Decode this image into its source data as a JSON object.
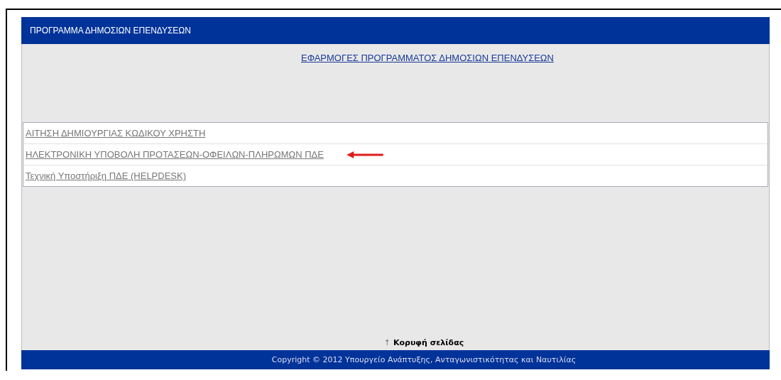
{
  "header": {
    "title": "ΠΡΟΓΡΑΜΜΑ ΔΗΜΟΣΙΩΝ ΕΠΕΝΔΥΣΕΩΝ"
  },
  "main": {
    "heading": "ΕΦΑΡΜΟΓΕΣ ΠΡΟΓΡΑΜΜΑΤΟΣ ΔΗΜΟΣΙΩΝ ΕΠΕΝΔΥΣΕΩΝ",
    "links": [
      {
        "label": "ΑΙΤΗΣΗ ΔΗΜΙΟΥΡΓΙΑΣ ΚΩΔΙΚΟΥ ΧΡΗΣΤΗ",
        "highlighted": false
      },
      {
        "label": "ΗΛΕΚΤΡΟΝΙΚΗ ΥΠΟΒΟΛΗ ΠΡΟΤΑΣΕΩΝ-ΟΦΕΙΛΩΝ-ΠΛΗΡΩΜΩΝ ΠΔΕ",
        "highlighted": true
      },
      {
        "label": "Τεχνική Υποστήριξη ΠΔΕ (HELPDESK)",
        "highlighted": false
      }
    ],
    "top_link": {
      "arrow": "↑",
      "label": "Κορυφή σελίδας"
    }
  },
  "footer": {
    "text": "Copyright © 2012 Υπουργείο Ανάπτυξης, Ανταγωνιστικότητας και Ναυτιλίας"
  }
}
